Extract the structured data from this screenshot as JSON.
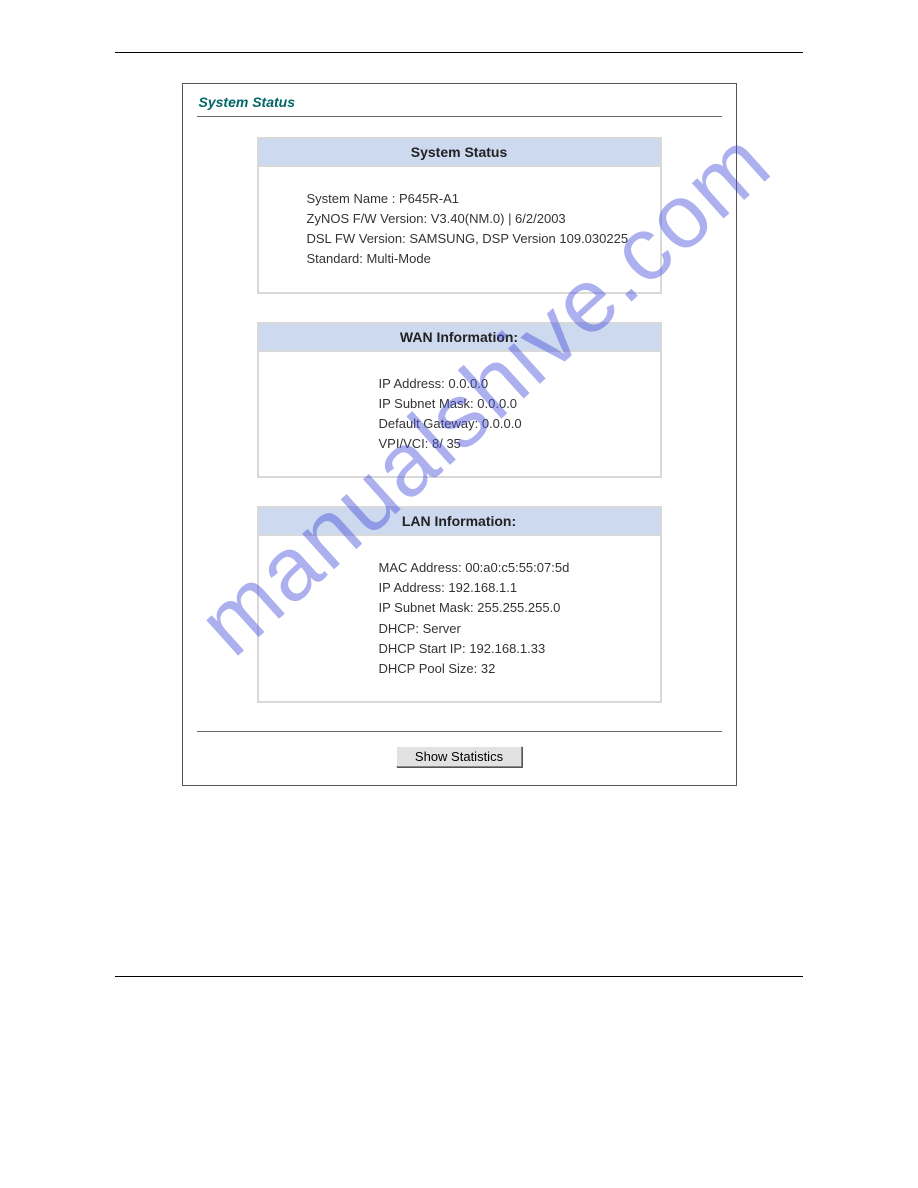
{
  "watermark": "manualshive.com",
  "page": {
    "title": "System Status"
  },
  "panels": {
    "system": {
      "header": "System Status",
      "rows": [
        {
          "label": "System Name :",
          "value": "P645R-A1"
        },
        {
          "label": "ZyNOS F/W Version:",
          "value": "V3.40(NM.0) | 6/2/2003"
        },
        {
          "label": "DSL FW Version:",
          "value": "SAMSUNG, DSP Version 109.030225"
        },
        {
          "label": "Standard:",
          "value": "Multi-Mode"
        }
      ]
    },
    "wan": {
      "header": "WAN Information:",
      "rows": [
        {
          "label": "IP Address:",
          "value": "0.0.0.0"
        },
        {
          "label": "IP Subnet Mask:",
          "value": "0.0.0.0"
        },
        {
          "label": "Default Gateway:",
          "value": "0.0.0.0"
        },
        {
          "label": "VPI/VCI:",
          "value": "8/ 35"
        }
      ]
    },
    "lan": {
      "header": "LAN Information:",
      "rows": [
        {
          "label": "MAC Address:",
          "value": "00:a0:c5:55:07:5d"
        },
        {
          "label": "IP Address:",
          "value": "192.168.1.1"
        },
        {
          "label": "IP Subnet Mask:",
          "value": "255.255.255.0"
        },
        {
          "label": "DHCP:",
          "value": "Server"
        },
        {
          "label": "DHCP Start IP:",
          "value": "192.168.1.33"
        },
        {
          "label": "DHCP Pool Size:",
          "value": "32"
        }
      ]
    }
  },
  "button": {
    "show_statistics": "Show Statistics"
  }
}
